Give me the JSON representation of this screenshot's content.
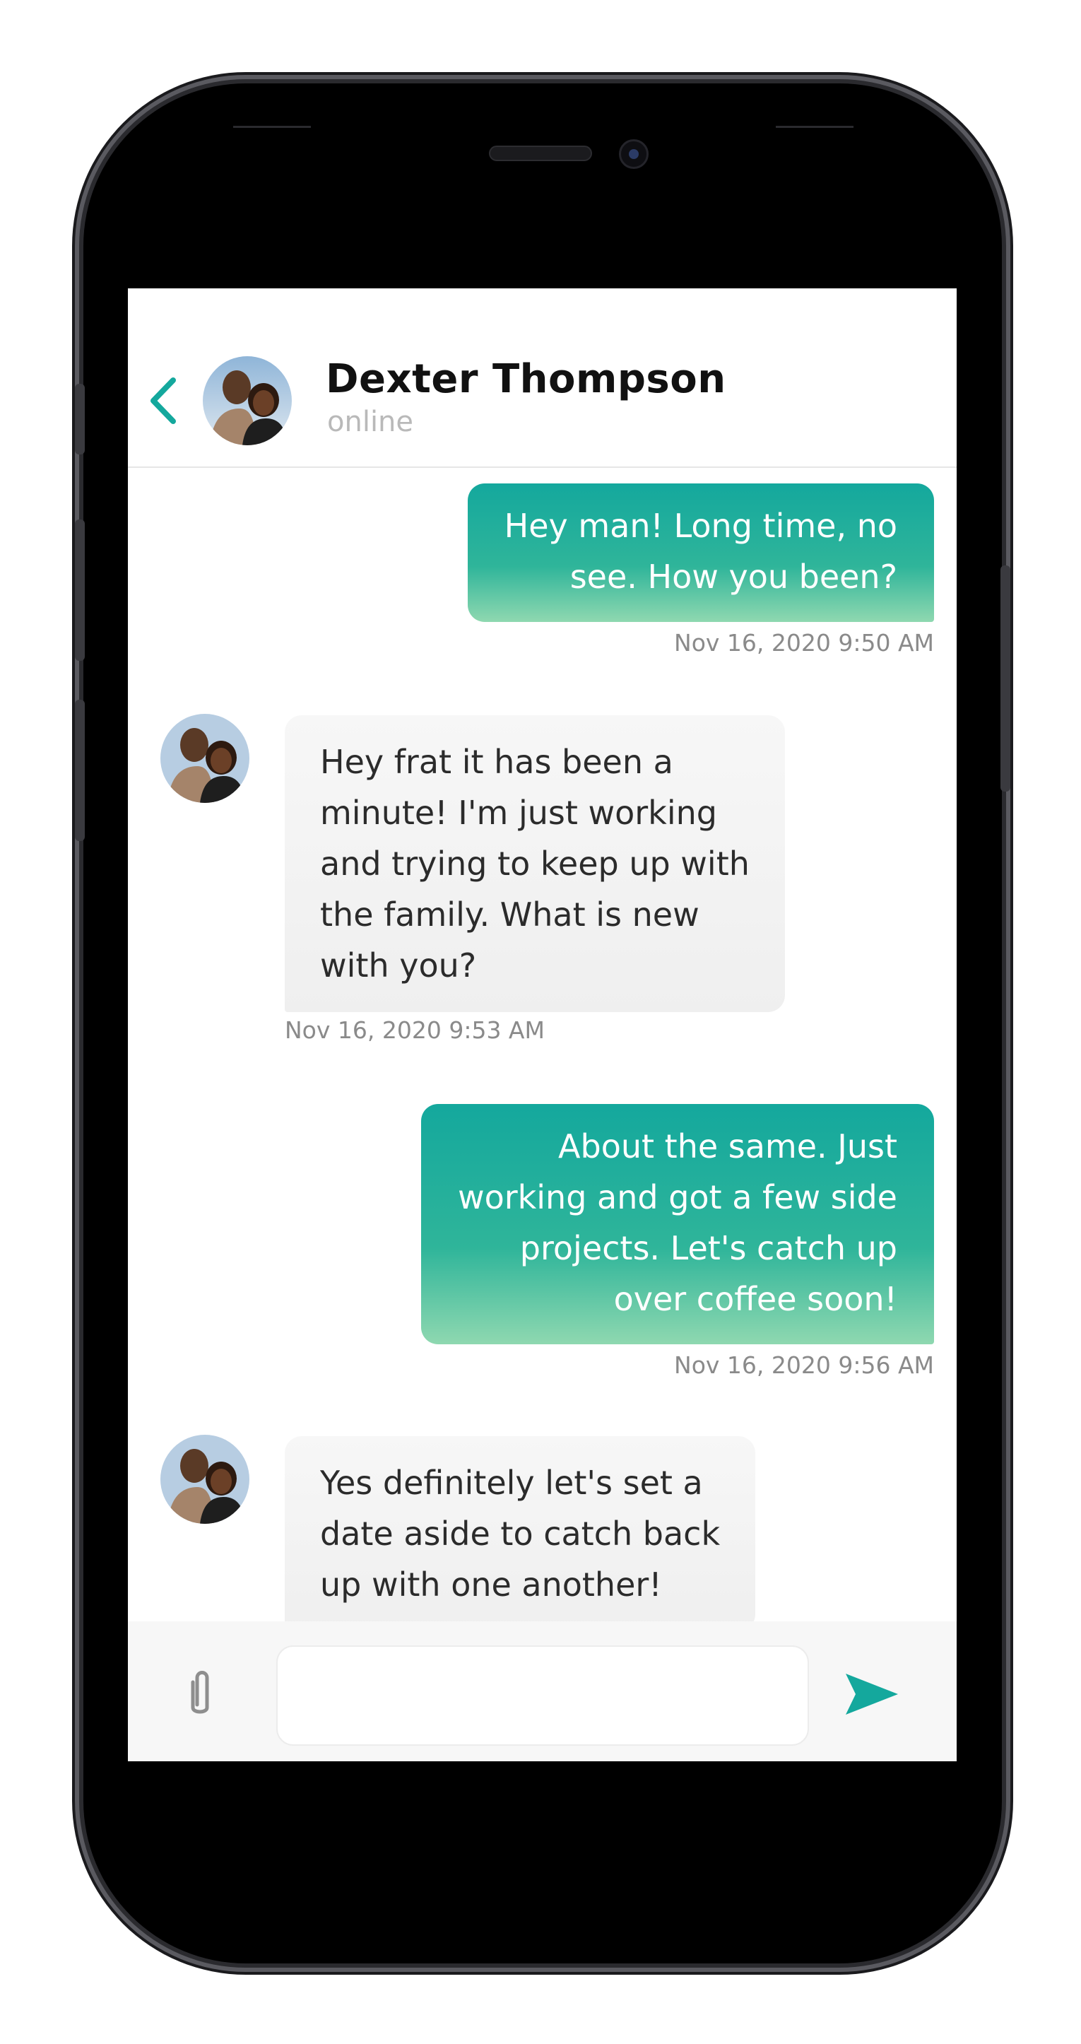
{
  "header": {
    "contact_name": "Dexter Thompson",
    "contact_status": "online"
  },
  "messages": [
    {
      "direction": "out",
      "lines": [
        "Hey man! Long time, no",
        "see. How you been?"
      ],
      "timestamp": "Nov 16, 2020 9:50 AM"
    },
    {
      "direction": "in",
      "lines": [
        "Hey frat it has been a",
        "minute! I'm just working",
        "and trying to keep up with",
        "the family. What is new",
        "with you?"
      ],
      "timestamp": "Nov 16, 2020 9:53 AM"
    },
    {
      "direction": "out",
      "lines": [
        "About the same. Just",
        "working and got a few side",
        "projects. Let's catch up",
        "over coffee soon!"
      ],
      "timestamp": "Nov 16, 2020 9:56 AM"
    },
    {
      "direction": "in",
      "lines": [
        "Yes definitely let's set a",
        "date aside to catch back",
        "up with one another!"
      ],
      "timestamp": ""
    }
  ],
  "composer": {
    "input_value": "",
    "input_placeholder": ""
  },
  "icons": {
    "back": "chevron-left-icon",
    "attach": "paperclip-icon",
    "send": "send-icon"
  },
  "colors": {
    "accent": "#14a89d",
    "outgoing_bubble_top": "#14a89d",
    "outgoing_bubble_bottom": "#8fd8b0",
    "incoming_bubble": "#f2f2f2",
    "status_indicator": "#f5d90a"
  }
}
